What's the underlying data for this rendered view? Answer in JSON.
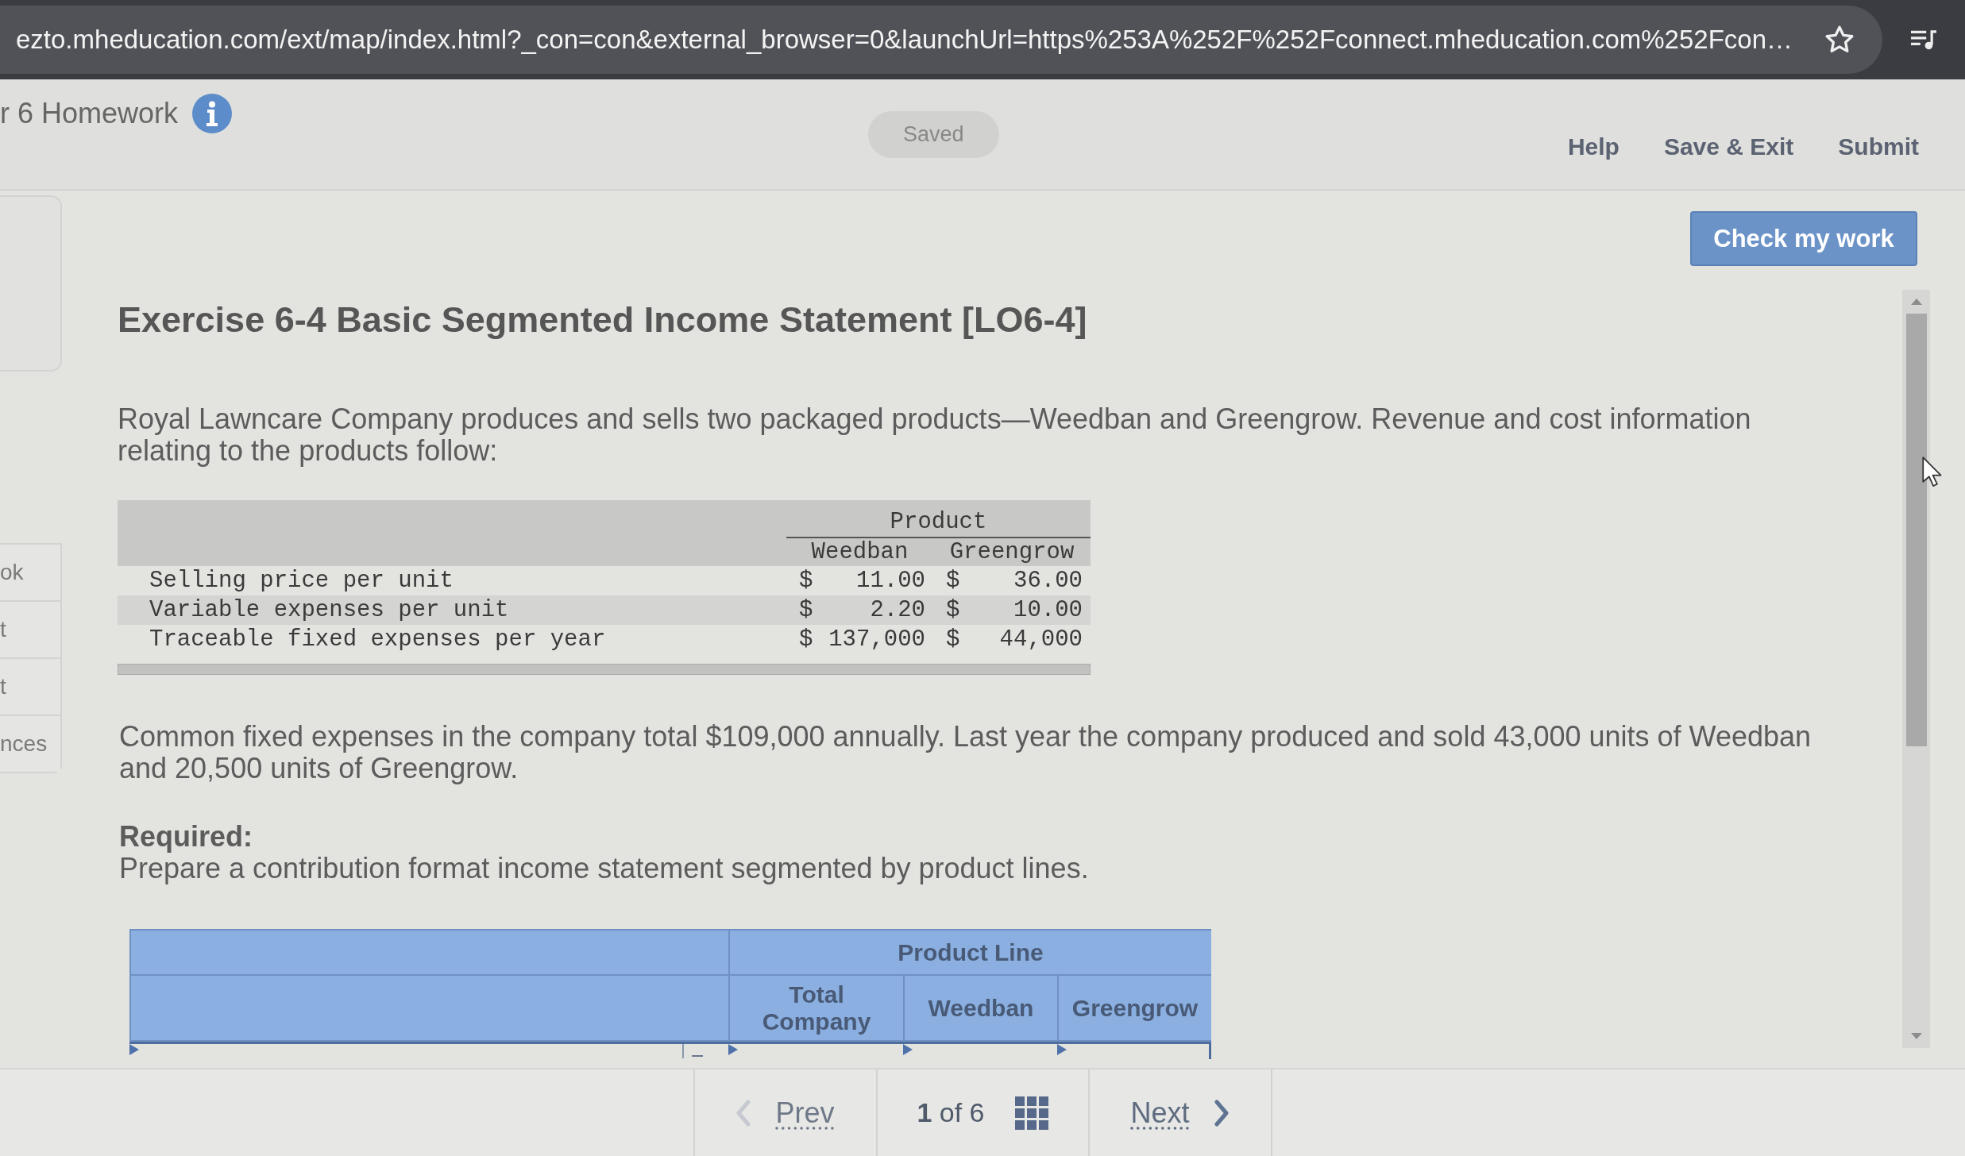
{
  "browser": {
    "url": "ezto.mheducation.com/ext/map/index.html?_con=con&external_browser=0&launchUrl=https%253A%252F%252Fconnect.mheducation.com%252Fcon…"
  },
  "header": {
    "title": "r 6 Homework",
    "status": "Saved",
    "links": [
      "Help",
      "Save & Exit",
      "Submit"
    ]
  },
  "sidebar": {
    "items": [
      "ok",
      "t",
      "t",
      "nces"
    ]
  },
  "check_button": "Check my work",
  "exercise": {
    "title": "Exercise 6-4 Basic Segmented Income Statement [LO6-4]",
    "intro": "Royal Lawncare Company produces and sells two packaged products—Weedban and Greengrow. Revenue and cost information relating to the products follow:",
    "data_table": {
      "group_header": "Product",
      "columns": [
        "Weedban",
        "Greengrow"
      ],
      "rows": [
        {
          "label": "Selling price per unit",
          "values": [
            {
              "currency": "$",
              "amount": "11.00"
            },
            {
              "currency": "$",
              "amount": "36.00"
            }
          ]
        },
        {
          "label": "Variable expenses per unit",
          "values": [
            {
              "currency": "$",
              "amount": "2.20"
            },
            {
              "currency": "$",
              "amount": "10.00"
            }
          ]
        },
        {
          "label": "Traceable fixed expenses per year",
          "values": [
            {
              "currency": "$",
              "amount": "137,000"
            },
            {
              "currency": "$",
              "amount": "44,000"
            }
          ]
        }
      ]
    },
    "paragraph": "Common fixed expenses in the company total $109,000 annually. Last year the company produced and sold 43,000 units of Weedban and 20,500 units of Greengrow.",
    "required": {
      "label": "Required:",
      "text": "Prepare a contribution format income statement segmented by product lines."
    }
  },
  "answer_table": {
    "group_header": "Product Line",
    "columns": [
      "Total Company",
      "Weedban",
      "Greengrow"
    ]
  },
  "pagination": {
    "prev": {
      "label": "Prev",
      "disabled": true
    },
    "position": "**1** of 6",
    "next": {
      "label": "Next",
      "disabled": false
    }
  }
}
